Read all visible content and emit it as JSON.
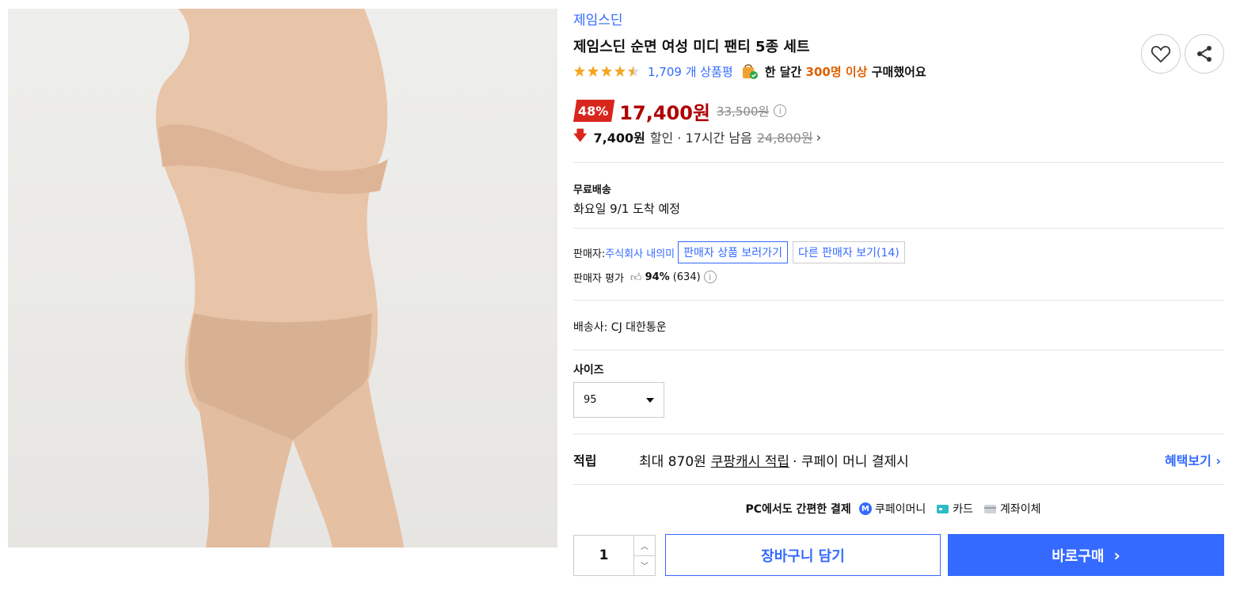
{
  "product": {
    "brand": "제임스딘",
    "title": "제임스딘 순면 여성 미디 팬티 5종 세트",
    "rating_value": 4.5,
    "review_count": "1,709 개 상품평",
    "monthly_buy_prefix": "한 달간",
    "monthly_buy_highlight": "300명 이상",
    "monthly_buy_suffix": "구매했어요"
  },
  "price": {
    "discount_rate": "48%",
    "sale_price": "17,400원",
    "original_price": "33,500원",
    "coupon_amount": "7,400원",
    "coupon_text": "할인 · 17시간 남음",
    "coupon_original": "24,800원"
  },
  "shipping": {
    "label": "무료배송",
    "arrival": "화요일 9/1 도착 예정"
  },
  "seller": {
    "prefix": "판매자:",
    "name": "주식회사 내의미",
    "view_products_label": "판매자 상품 보러가기",
    "other_sellers_label": "다른 판매자 보기(14)",
    "rating_label": "판매자 평가",
    "rating_pct": "94%",
    "rating_count": "(634)"
  },
  "carrier": {
    "text": "배송사:  CJ 대한통운"
  },
  "size": {
    "label": "사이즈",
    "selected": "95"
  },
  "reward": {
    "label": "적립",
    "text": "최대 870원",
    "link": "쿠팡캐시 적립",
    "after": "· 쿠페이 머니 결제시",
    "benefit_label": "혜택보기 ›"
  },
  "payment": {
    "title": "PC에서도 간편한 결제",
    "coupay_label": "쿠페이머니",
    "card_label": "카드",
    "bank_label": "계좌이체"
  },
  "purchase": {
    "quantity": "1",
    "cart_label": "장바구니 담기",
    "buy_label": "바로구매"
  },
  "colors": {
    "accent": "#346aff",
    "price_red": "#ae0000",
    "badge_red": "#d8261d",
    "highlight_orange": "#e06000"
  },
  "icons": [
    "heart-icon",
    "share-icon",
    "star-icon",
    "shopping-bag-icon",
    "down-arrow-icon",
    "info-icon",
    "thumbs-up-icon",
    "caret-down-icon",
    "chevron-right-icon",
    "coupay-icon",
    "card-icon",
    "bank-icon"
  ]
}
